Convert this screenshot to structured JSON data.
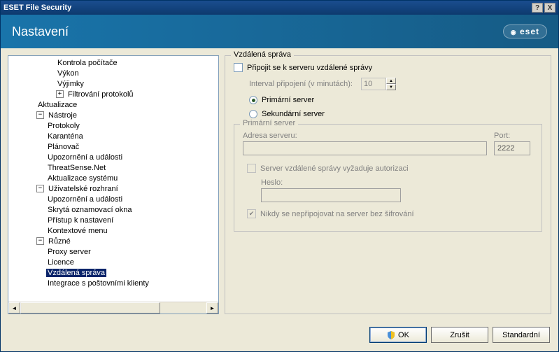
{
  "window": {
    "title": "ESET File Security",
    "help": "?",
    "close": "X"
  },
  "header": {
    "title": "Nastavení",
    "logo": "eset"
  },
  "tree": {
    "items": [
      {
        "level": 3,
        "expander": "",
        "label": "Kontrola počítače"
      },
      {
        "level": 3,
        "expander": "",
        "label": "Výkon"
      },
      {
        "level": 3,
        "expander": "",
        "label": "Výjimky"
      },
      {
        "level": 3,
        "expander": "+",
        "label": "Filtrování protokolů"
      },
      {
        "level": 2,
        "expander": "",
        "label": "Aktualizace"
      },
      {
        "level": 2,
        "expander": "-",
        "label": "Nástroje"
      },
      {
        "level": 2,
        "expander": "",
        "label": "Protokoly",
        "sub": true
      },
      {
        "level": 2,
        "expander": "",
        "label": "Karanténa",
        "sub": true
      },
      {
        "level": 2,
        "expander": "",
        "label": "Plánovač",
        "sub": true
      },
      {
        "level": 2,
        "expander": "",
        "label": "Upozornění a události",
        "sub": true
      },
      {
        "level": 2,
        "expander": "",
        "label": "ThreatSense.Net",
        "sub": true
      },
      {
        "level": 2,
        "expander": "",
        "label": "Aktualizace systému",
        "sub": true
      },
      {
        "level": 2,
        "expander": "-",
        "label": "Uživatelské rozhraní"
      },
      {
        "level": 2,
        "expander": "",
        "label": "Upozornění a události",
        "sub": true
      },
      {
        "level": 2,
        "expander": "",
        "label": "Skrytá oznamovací okna",
        "sub": true
      },
      {
        "level": 2,
        "expander": "",
        "label": "Přístup k nastavení",
        "sub": true
      },
      {
        "level": 2,
        "expander": "",
        "label": "Kontextové menu",
        "sub": true
      },
      {
        "level": 2,
        "expander": "-",
        "label": "Různé"
      },
      {
        "level": 2,
        "expander": "",
        "label": "Proxy server",
        "sub": true
      },
      {
        "level": 2,
        "expander": "",
        "label": "Licence",
        "sub": true
      },
      {
        "level": 2,
        "expander": "",
        "label": "Vzdálená správa",
        "sub": true,
        "selected": true
      },
      {
        "level": 2,
        "expander": "",
        "label": "Integrace s poštovními klienty",
        "sub": true
      }
    ]
  },
  "panel": {
    "group_title": "Vzdálená správa",
    "connect_label": "Připojit se k serveru vzdálené správy",
    "interval_label": "Interval připojení (v minutách):",
    "interval_value": "10",
    "primary_label": "Primární server",
    "secondary_label": "Sekundární server",
    "server_group_title": "Primární server",
    "address_label": "Adresa serveru:",
    "port_label": "Port:",
    "port_value": "2222",
    "auth_label": "Server vzdálené správy vyžaduje autorizaci",
    "password_label": "Heslo:",
    "no_encrypt_label": "Nikdy se nepřipojovat na server bez šifrování"
  },
  "buttons": {
    "ok": "OK",
    "cancel": "Zrušit",
    "default": "Standardní"
  }
}
